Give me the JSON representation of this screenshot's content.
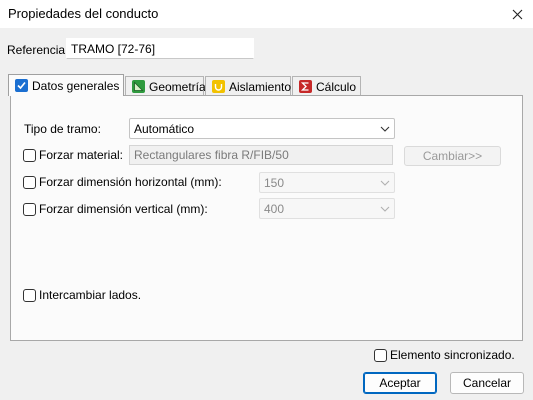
{
  "window": {
    "title": "Propiedades del conducto"
  },
  "reference": {
    "label": "Referencia:",
    "value": "TRAMO [72-76]"
  },
  "tabs": [
    {
      "label": "Datos generales",
      "icon": "checkbox-icon",
      "active": true
    },
    {
      "label": "Geometría",
      "icon": "geometry-icon",
      "active": false
    },
    {
      "label": "Aislamiento",
      "icon": "insulation-icon",
      "active": false
    },
    {
      "label": "Cálculo",
      "icon": "sigma-icon",
      "active": false
    }
  ],
  "general": {
    "tipo_tramo_label": "Tipo de tramo:",
    "tipo_tramo_value": "Automático",
    "forzar_material_label": "Forzar material:",
    "material_value": "Rectangulares fibra R/FIB/50",
    "cambiar_label": "Cambiar>>",
    "forzar_horizontal_label": "Forzar dimensión horizontal (mm):",
    "horizontal_value": "150",
    "forzar_vertical_label": "Forzar dimensión vertical (mm):",
    "vertical_value": "400",
    "intercambiar_label": "Intercambiar lados."
  },
  "footer": {
    "sincronizado_label": "Elemento sincronizado.",
    "accept_label": "Aceptar",
    "cancel_label": "Cancelar"
  },
  "colors": {
    "accent": "#0067c0",
    "calc_icon": "#c62828",
    "geometry_icon": "#2e9a3e",
    "insulation_icon": "#f2c200"
  }
}
